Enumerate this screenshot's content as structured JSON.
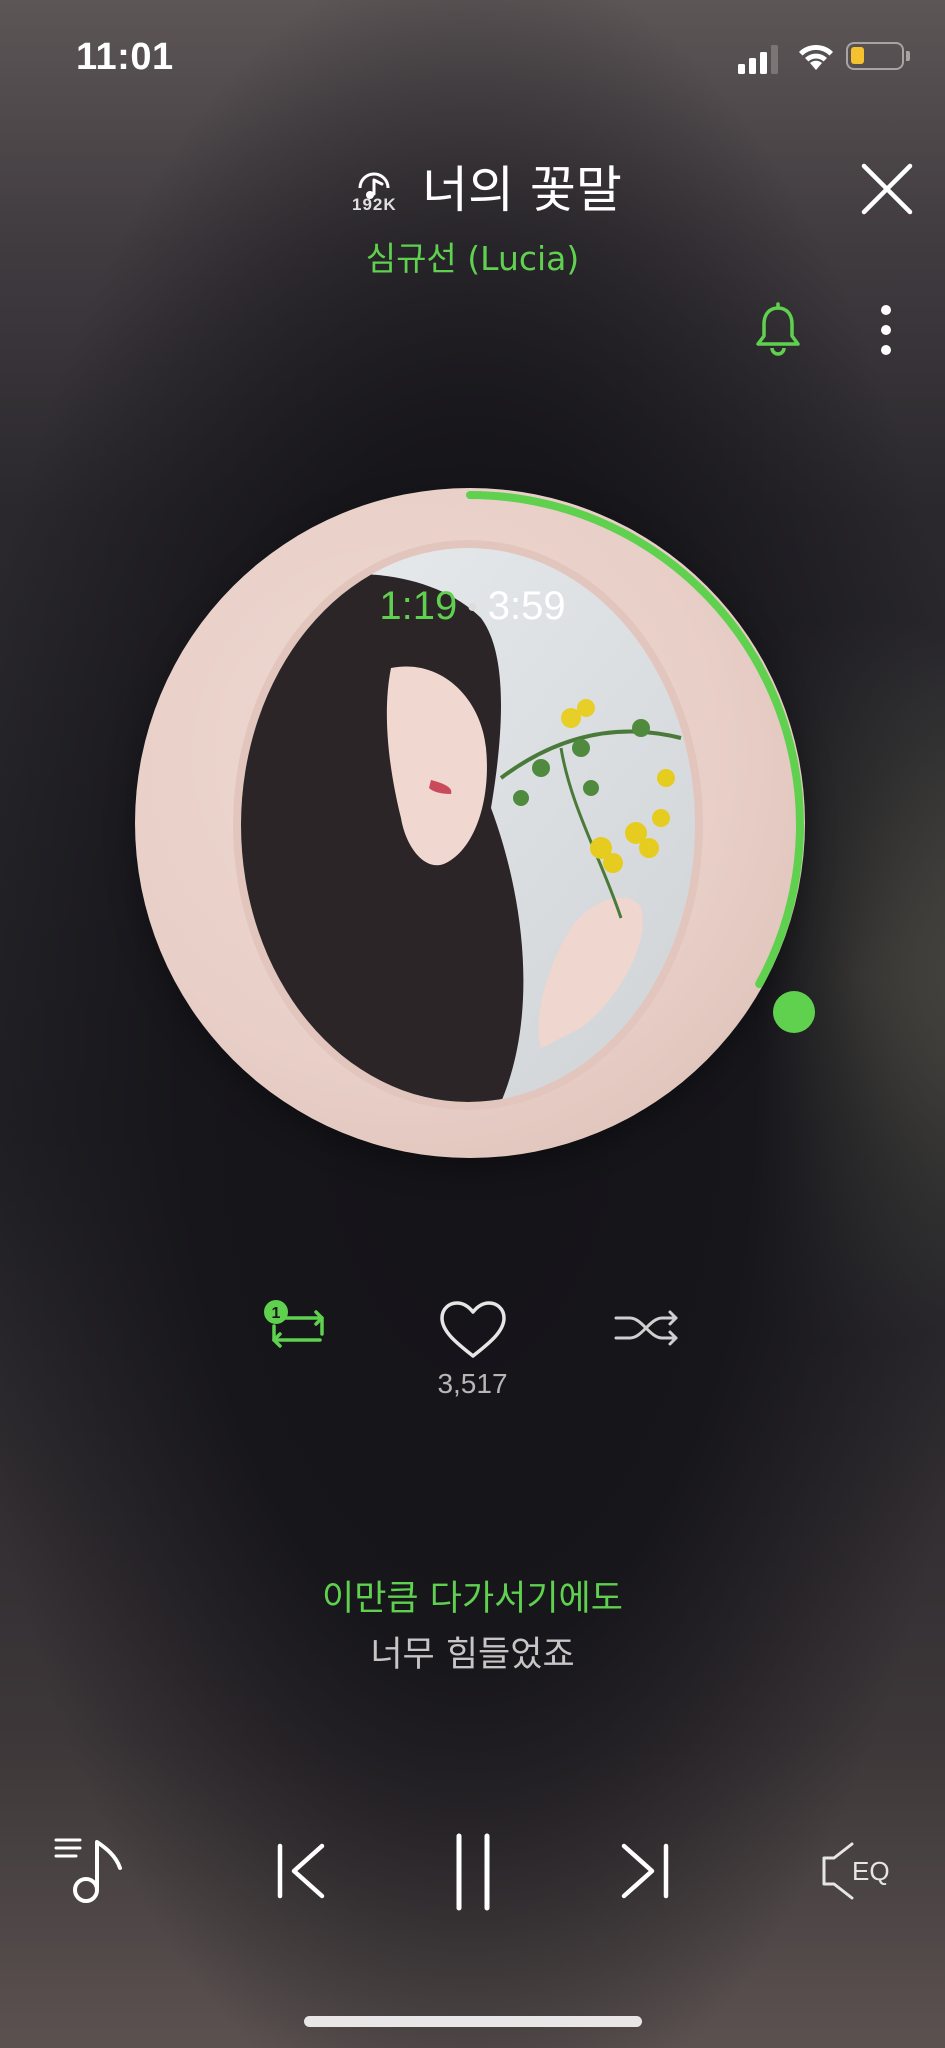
{
  "status_bar": {
    "time": "11:01",
    "icons": [
      "cellular-signal-icon",
      "wifi-icon",
      "battery-icon"
    ]
  },
  "header": {
    "quality_label": "192K",
    "song_title": "너의 꽃말",
    "artist": "심규선 (Lucia)"
  },
  "player": {
    "elapsed": "1:19",
    "separator": "•",
    "duration": "3:59",
    "progress_fraction": 0.33,
    "repeat_badge": "1",
    "like_count": "3,517"
  },
  "lyrics": {
    "current": "이만큼 다가서기에도",
    "next": "너무 힘들었죠"
  },
  "controls": {
    "eq_label": "EQ"
  },
  "colors": {
    "accent": "#5fd14f",
    "text_primary": "#ffffff",
    "text_secondary": "#c8c5c5"
  }
}
